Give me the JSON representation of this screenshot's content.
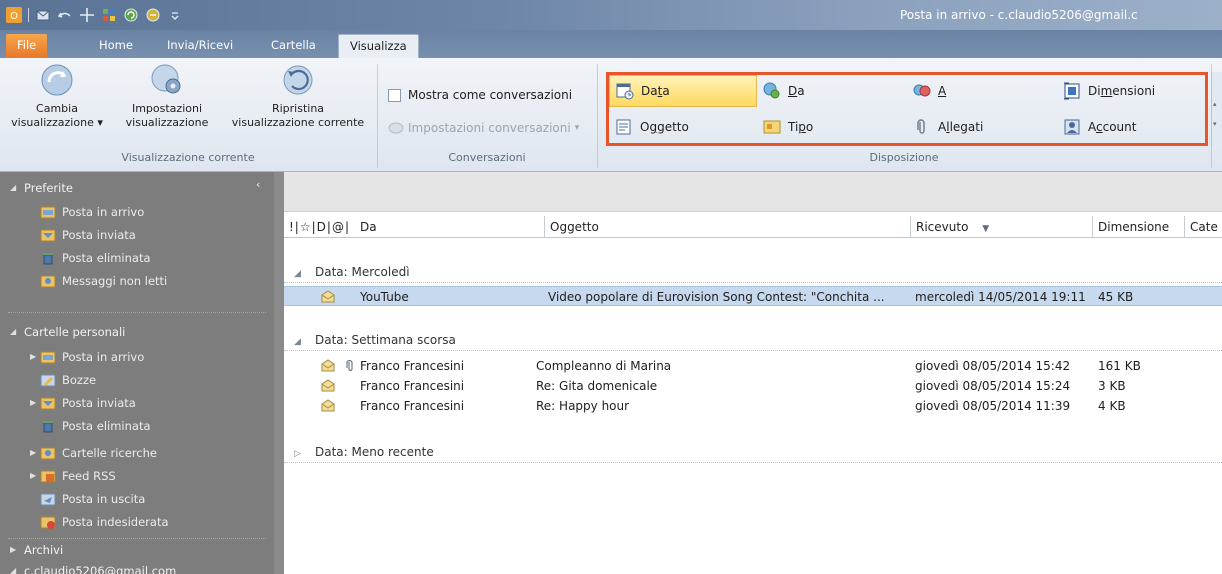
{
  "window": {
    "title": "Posta in arrivo - c.claudio5206@gmail.c"
  },
  "ribbon_tabs": [
    {
      "label": "File"
    },
    {
      "label": "Home"
    },
    {
      "label": "Invia/Ricevi"
    },
    {
      "label": "Cartella"
    },
    {
      "label": "Visualizza",
      "active": true
    }
  ],
  "ribbon": {
    "visualizzazione_corrente": {
      "group_label": "Visualizzazione corrente",
      "cambia_line1": "Cambia",
      "cambia_line2": "visualizzazione",
      "impostazioni_line1": "Impostazioni",
      "impostazioni_line2": "visualizzazione",
      "ripristina_line1": "Ripristina",
      "ripristina_line2": "visualizzazione corrente"
    },
    "conversazioni": {
      "group_label": "Conversazioni",
      "mostra_label": "Mostra come conversazioni",
      "impostazioni_label": "Impostazioni conversazioni"
    },
    "disposizione": {
      "group_label": "Disposizione",
      "items": {
        "data": {
          "prefix": "Da",
          "underline": "t",
          "suffix": "a",
          "selected": true
        },
        "da": {
          "prefix": "",
          "underline": "D",
          "suffix": "a"
        },
        "a": {
          "prefix": "",
          "underline": "A",
          "suffix": ""
        },
        "dimensioni": {
          "prefix": "Di",
          "underline": "m",
          "suffix": "ensioni"
        },
        "oggetto": {
          "prefix": "O",
          "underline": "g",
          "suffix": "getto"
        },
        "tipo": {
          "prefix": "Ti",
          "underline": "p",
          "suffix": "o"
        },
        "allegati": {
          "prefix": "A",
          "underline": "l",
          "suffix": "legati"
        },
        "account": {
          "prefix": "A",
          "underline": "c",
          "suffix": "count"
        }
      }
    }
  },
  "nav": {
    "preferite_header": "Preferite",
    "preferite": [
      {
        "label": "Posta in arrivo"
      },
      {
        "label": "Posta inviata"
      },
      {
        "label": "Posta eliminata"
      },
      {
        "label": "Messaggi non letti"
      }
    ],
    "cartelle_header": "Cartelle personali",
    "cartelle": [
      {
        "label": "Posta in arrivo"
      },
      {
        "label": "Bozze"
      },
      {
        "label": "Posta inviata"
      },
      {
        "label": "Posta eliminata"
      },
      {
        "label": "Cartelle ricerche"
      },
      {
        "label": "Feed RSS"
      },
      {
        "label": "Posta in uscita"
      },
      {
        "label": "Posta indesiderata"
      }
    ],
    "archivi_header": "Archivi",
    "account_header": "c.claudio5206@gmail.com"
  },
  "columns": {
    "icons": "!|☆|D|@|",
    "da": "Da",
    "oggetto": "Oggetto",
    "ricevuto": "Ricevuto",
    "dimensione": "Dimensione",
    "categorie": "Cate"
  },
  "groups": [
    {
      "label": "Data: Mercoledì",
      "messages": [
        {
          "from": "YouTube",
          "subject": "Video popolare di Eurovision Song Contest: \"Conchita ...",
          "received": "mercoledì 14/05/2014 19:11",
          "size": "45 KB",
          "attachment": false,
          "selected": true
        }
      ]
    },
    {
      "label": "Data: Settimana scorsa",
      "messages": [
        {
          "from": "Franco Francesini",
          "subject": "Compleanno di Marina",
          "received": "giovedì 08/05/2014 15:42",
          "size": "161 KB",
          "attachment": true
        },
        {
          "from": "Franco Francesini",
          "subject": "Re: Gita domenicale",
          "received": "giovedì 08/05/2014 15:24",
          "size": "3 KB",
          "attachment": false
        },
        {
          "from": "Franco Francesini",
          "subject": "Re: Happy hour",
          "received": "giovedì 08/05/2014 11:39",
          "size": "4 KB",
          "attachment": false
        }
      ]
    },
    {
      "label": "Data: Meno recente",
      "collapsed": true,
      "messages": []
    }
  ]
}
